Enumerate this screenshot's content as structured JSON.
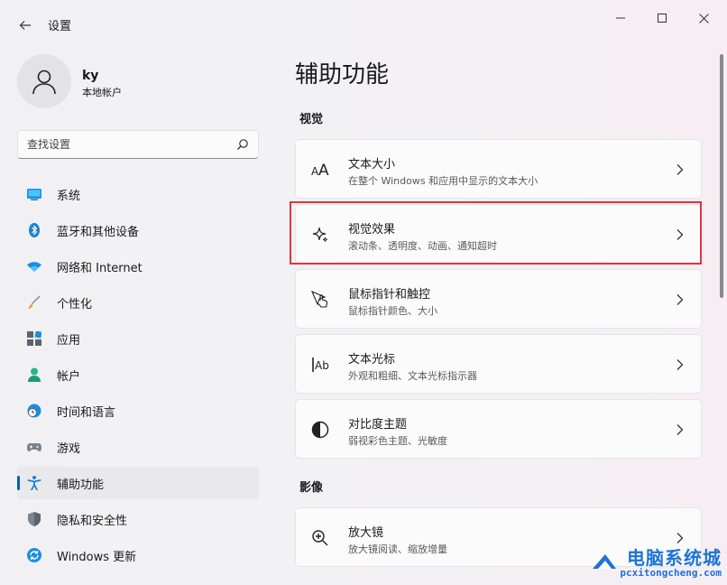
{
  "window": {
    "title": "设置"
  },
  "profile": {
    "name": "ky",
    "account_type": "本地帐户"
  },
  "search": {
    "placeholder": "查找设置"
  },
  "sidebar": {
    "items": [
      {
        "label": "系统",
        "icon": "system-icon",
        "selected": false
      },
      {
        "label": "蓝牙和其他设备",
        "icon": "bluetooth-icon",
        "selected": false
      },
      {
        "label": "网络和 Internet",
        "icon": "wifi-icon",
        "selected": false
      },
      {
        "label": "个性化",
        "icon": "brush-icon",
        "selected": false
      },
      {
        "label": "应用",
        "icon": "apps-icon",
        "selected": false
      },
      {
        "label": "帐户",
        "icon": "account-icon",
        "selected": false
      },
      {
        "label": "时间和语言",
        "icon": "globe-clock-icon",
        "selected": false
      },
      {
        "label": "游戏",
        "icon": "gamepad-icon",
        "selected": false
      },
      {
        "label": "辅助功能",
        "icon": "accessibility-icon",
        "selected": true
      },
      {
        "label": "隐私和安全性",
        "icon": "shield-icon",
        "selected": false
      },
      {
        "label": "Windows 更新",
        "icon": "update-icon",
        "selected": false
      }
    ]
  },
  "main": {
    "title": "辅助功能",
    "sections": [
      {
        "heading": "视觉",
        "cards": [
          {
            "title": "文本大小",
            "subtitle": "在整个 Windows 和应用中显示的文本大小",
            "icon": "text-size-icon"
          },
          {
            "title": "视觉效果",
            "subtitle": "滚动条、透明度、动画、通知超时",
            "icon": "sparkle-icon",
            "highlighted": true
          },
          {
            "title": "鼠标指针和触控",
            "subtitle": "鼠标指针颜色、大小",
            "icon": "pointer-touch-icon"
          },
          {
            "title": "文本光标",
            "subtitle": "外观和粗细、文本光标指示器",
            "icon": "text-cursor-icon"
          },
          {
            "title": "对比度主题",
            "subtitle": "弱视彩色主题、光敏度",
            "icon": "contrast-icon"
          }
        ]
      },
      {
        "heading": "影像",
        "cards": [
          {
            "title": "放大镜",
            "subtitle": "放大镜阅读、缩放增量",
            "icon": "magnifier-icon"
          }
        ]
      }
    ]
  },
  "watermark": {
    "title": "电脑系统城",
    "url": "pcxitongcheng.com"
  },
  "colors": {
    "accent": "#005fb8",
    "highlight_border": "#e0353b",
    "watermark": "#1e73d8"
  }
}
